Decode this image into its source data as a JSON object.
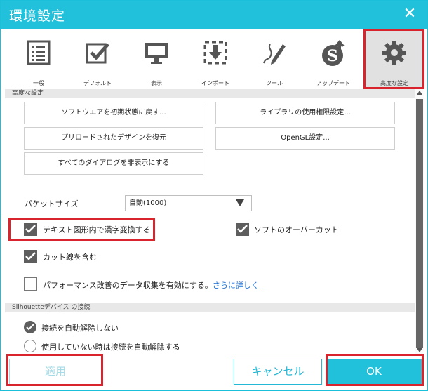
{
  "window": {
    "title": "環境設定",
    "close_label": "✕"
  },
  "toolbar": {
    "items": [
      {
        "label": "一般",
        "icon": "list-document-icon"
      },
      {
        "label": "デフォルト",
        "icon": "checkbox-icon"
      },
      {
        "label": "表示",
        "icon": "monitor-icon"
      },
      {
        "label": "インポート",
        "icon": "import-icon"
      },
      {
        "label": "ツール",
        "icon": "pen-tool-icon"
      },
      {
        "label": "アップデート",
        "icon": "update-icon"
      },
      {
        "label": "高度な設定",
        "icon": "gear-icon",
        "active": true
      }
    ]
  },
  "advanced": {
    "section_title": "高度な設定",
    "buttons": {
      "reset_software": "ソフトウエアを初期状態に戻す...",
      "library_permissions": "ライブラリの使用権限設定...",
      "restore_preloaded": "プリロードされたデザインを復元",
      "opengl_settings": "OpenGL設定...",
      "unhide_dialogs": "すべてのダイアログを非表示にする"
    },
    "packet_size": {
      "label": "パケットサイズ",
      "value": "自動(1000)"
    },
    "checkboxes": {
      "kanji_convert": {
        "label": "テキスト図形内で漢字変換する",
        "checked": true
      },
      "software_overcut": {
        "label": "ソフトのオーバーカット",
        "checked": true
      },
      "include_cut_lines": {
        "label": "カット線を含む",
        "checked": true
      },
      "performance_data": {
        "label": "パフォーマンス改善のデータ収集を有効にする。",
        "link": "さらに詳しく",
        "checked": false
      }
    }
  },
  "connection": {
    "section_title": "Silhouetteデバイス の接続",
    "options": [
      {
        "label": "接続を自動解除しない",
        "selected": true
      },
      {
        "label": "使用していない時は接続を自動解除する",
        "selected": false
      }
    ]
  },
  "footer": {
    "apply": "適用",
    "cancel": "キャンセル",
    "ok": "OK"
  },
  "colors": {
    "accent": "#22c1db",
    "highlight_box": "#d9232d",
    "checkbox_fill": "#5e5e5e"
  }
}
